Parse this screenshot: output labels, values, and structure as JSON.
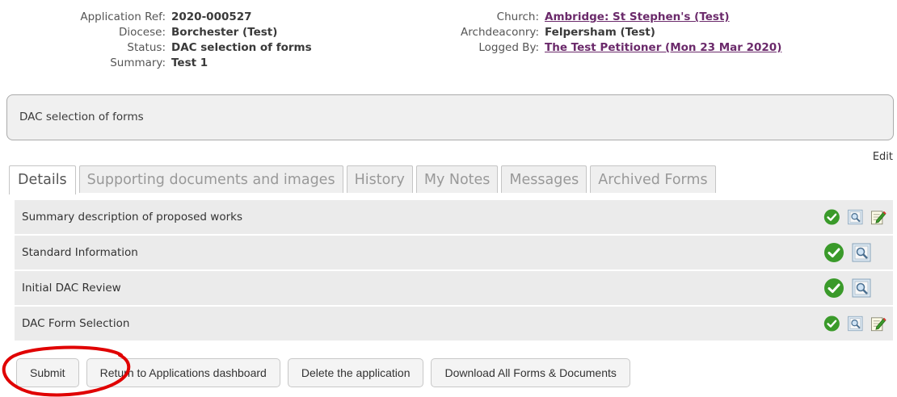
{
  "application": {
    "left": [
      {
        "label": "Application Ref:",
        "value": "2020-000527"
      },
      {
        "label": "Diocese:",
        "value": "Borchester (Test)"
      },
      {
        "label": "Status:",
        "value": "DAC selection of forms"
      },
      {
        "label": "Summary:",
        "value": "Test 1"
      }
    ],
    "right": [
      {
        "label": "Church:",
        "value": "Ambridge: St Stephen's (Test)"
      },
      {
        "label": "Archdeaconry:",
        "value": "Felpersham (Test)"
      },
      {
        "label": "Logged By:",
        "value": "The Test Petitioner (Mon 23 Mar 2020)"
      }
    ]
  },
  "status_box": {
    "text": "DAC selection of forms"
  },
  "edit_link": "Edit",
  "tabs": [
    {
      "label": "Details",
      "active": true
    },
    {
      "label": "Supporting documents and images"
    },
    {
      "label": "History"
    },
    {
      "label": "My Notes"
    },
    {
      "label": "Messages"
    },
    {
      "label": "Archived Forms"
    }
  ],
  "forms": [
    {
      "name": "Summary description of proposed works",
      "icons": [
        "check-icon",
        "view-icon",
        "edit-icon"
      ]
    },
    {
      "name": "Standard Information",
      "icons": [
        "check-icon",
        "view-icon"
      ]
    },
    {
      "name": "Initial DAC Review",
      "icons": [
        "check-icon",
        "view-icon"
      ]
    },
    {
      "name": "DAC Form Selection",
      "icons": [
        "check-icon",
        "view-icon",
        "edit-icon"
      ]
    }
  ],
  "buttons": {
    "submit": "Submit",
    "return": "Return to Applications dashboard",
    "delete": "Delete the application",
    "download": "Download All Forms & Documents"
  },
  "colors": {
    "link": "#6b2a6b",
    "check": "#3a9a2a",
    "annotation": "#e00000"
  }
}
